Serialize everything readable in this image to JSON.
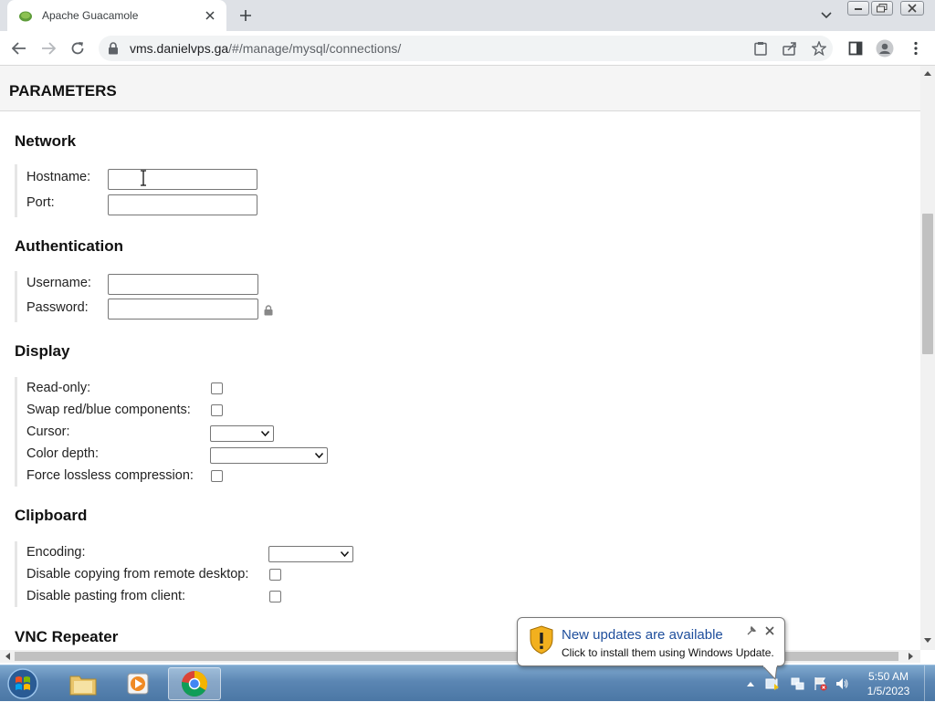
{
  "browser": {
    "tab_title": "Apache Guacamole",
    "url_host": "vms.danielvps.ga",
    "url_path": "/#/manage/mysql/connections/"
  },
  "page": {
    "section_title": "PARAMETERS",
    "groups": {
      "network": {
        "title": "Network",
        "hostname_label": "Hostname:",
        "hostname_value": "",
        "port_label": "Port:",
        "port_value": ""
      },
      "authentication": {
        "title": "Authentication",
        "username_label": "Username:",
        "username_value": "",
        "password_label": "Password:",
        "password_value": ""
      },
      "display": {
        "title": "Display",
        "read_only_label": "Read-only:",
        "swap_red_blue_label": "Swap red/blue components:",
        "cursor_label": "Cursor:",
        "cursor_value": "",
        "color_depth_label": "Color depth:",
        "color_depth_value": "",
        "force_lossless_label": "Force lossless compression:"
      },
      "clipboard": {
        "title": "Clipboard",
        "encoding_label": "Encoding:",
        "encoding_value": "",
        "disable_copy_label": "Disable copying from remote desktop:",
        "disable_paste_label": "Disable pasting from client:"
      },
      "vnc_repeater": {
        "title": "VNC Repeater"
      }
    }
  },
  "notification": {
    "title": "New updates are available",
    "text": "Click to install them using Windows Update."
  },
  "taskbar": {
    "time": "5:50 AM",
    "date": "1/5/2023"
  },
  "icons": {
    "tab_favicon": "guacamole-icon",
    "lock": "lock-icon",
    "password_lock": "lock-icon",
    "warning": "shield-warning-icon"
  },
  "colors": {
    "tabstrip_bg": "#dee1e6",
    "section_header_bg": "#f5f5f5",
    "balloon_title": "#1e4e9c",
    "taskbar": "#5b86b3"
  }
}
